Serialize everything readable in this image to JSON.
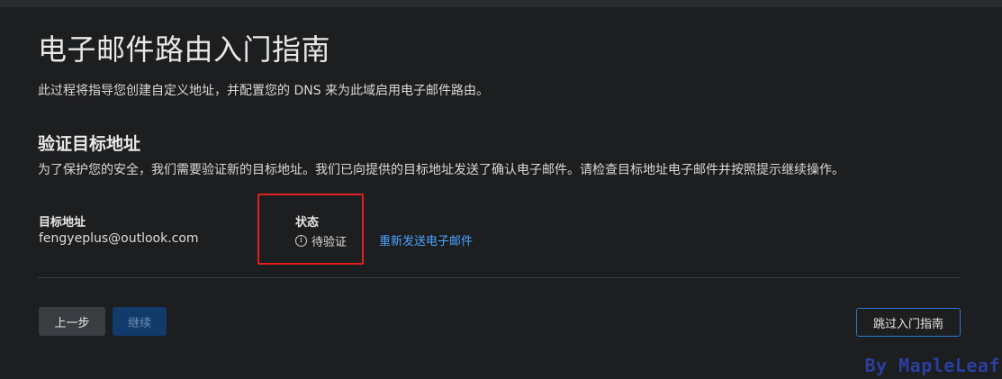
{
  "header": {
    "title": "电子邮件路由入门指南",
    "subtitle": "此过程将指导您创建自定义地址，并配置您的 DNS 来为此域启用电子邮件路由。"
  },
  "section": {
    "title": "验证目标地址",
    "description": "为了保护您的安全，我们需要验证新的目标地址。我们已向提供的目标地址发送了确认电子邮件。请检查目标地址电子邮件并按照提示继续操作。"
  },
  "destination": {
    "label": "目标地址",
    "value": "fengyeplus@outlook.com"
  },
  "status": {
    "label": "状态",
    "value": "待验证",
    "icon": "info-circle-icon"
  },
  "resend_link": "重新发送电子邮件",
  "buttons": {
    "back": "上一步",
    "continue": "继续",
    "skip": "跳过入门指南"
  },
  "watermark": "By MapleLeaf",
  "colors": {
    "background": "#1d1e20",
    "link": "#4aa3ff",
    "highlight": "#e02020",
    "primary_disabled": "#123a6b",
    "outline": "#2b78d4"
  }
}
